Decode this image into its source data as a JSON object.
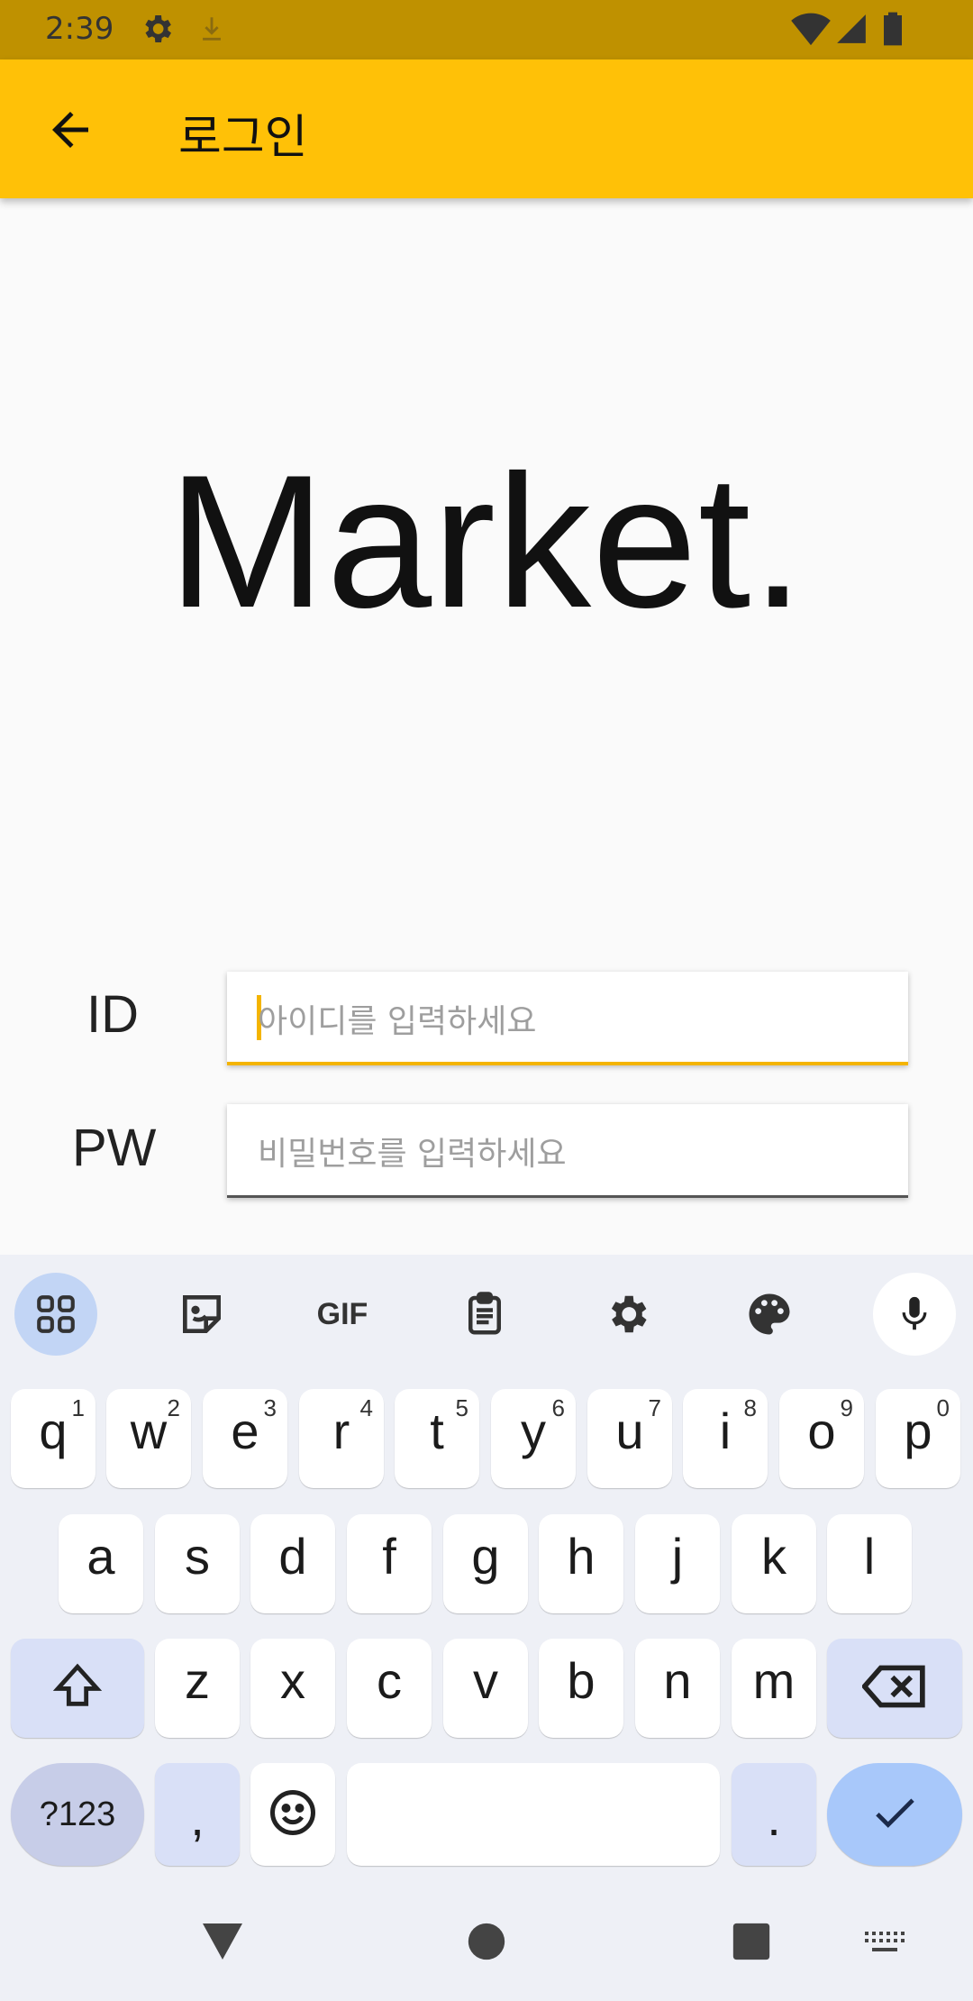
{
  "status_bar": {
    "time": "2:39",
    "icons": [
      "gear-icon",
      "download-icon",
      "wifi-icon",
      "signal-icon",
      "battery-icon"
    ]
  },
  "app_bar": {
    "title": "로그인",
    "back_icon": "arrow-back-icon",
    "color": "#ffc107"
  },
  "logo": {
    "text": "Market."
  },
  "form": {
    "id_label": "ID",
    "id_placeholder": "아이디를 입력하세요",
    "pw_label": "PW",
    "pw_placeholder": "비밀번호를 입력하세요"
  },
  "keyboard": {
    "toolbar": [
      "apps-icon",
      "sticker-icon",
      "GIF",
      "clipboard-icon",
      "settings-icon",
      "palette-icon",
      "mic-icon"
    ],
    "gif_label": "GIF",
    "row1": [
      {
        "ch": "q",
        "hint": "1"
      },
      {
        "ch": "w",
        "hint": "2"
      },
      {
        "ch": "e",
        "hint": "3"
      },
      {
        "ch": "r",
        "hint": "4"
      },
      {
        "ch": "t",
        "hint": "5"
      },
      {
        "ch": "y",
        "hint": "6"
      },
      {
        "ch": "u",
        "hint": "7"
      },
      {
        "ch": "i",
        "hint": "8"
      },
      {
        "ch": "o",
        "hint": "9"
      },
      {
        "ch": "p",
        "hint": "0"
      }
    ],
    "row2": [
      "a",
      "s",
      "d",
      "f",
      "g",
      "h",
      "j",
      "k",
      "l"
    ],
    "row3": [
      "z",
      "x",
      "c",
      "v",
      "b",
      "n",
      "m"
    ],
    "sym_label": "?123",
    "comma": ",",
    "period": ".",
    "accent": "#a8c8fa"
  },
  "nav_bar": {
    "icons": [
      "back-triangle-icon",
      "home-circle-icon",
      "recents-square-icon",
      "keyboard-switch-icon"
    ]
  }
}
